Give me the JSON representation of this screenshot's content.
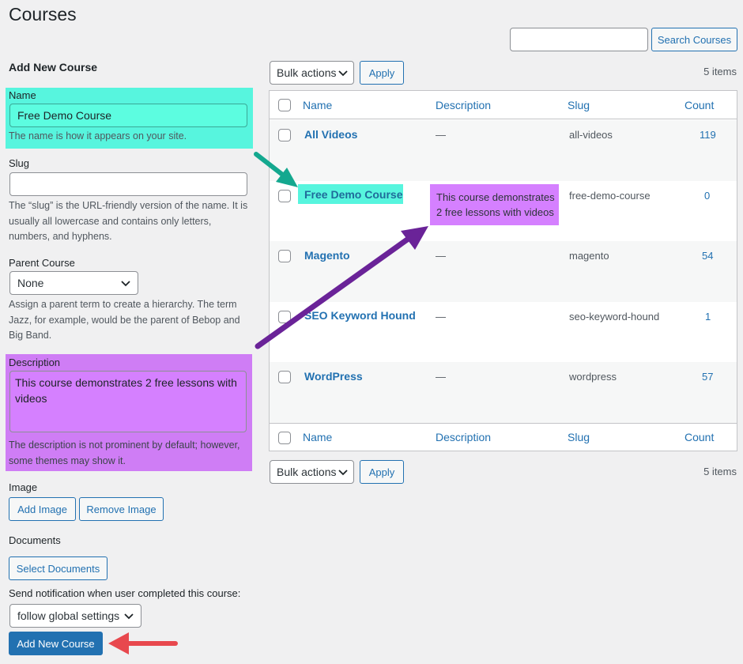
{
  "page": {
    "title": "Courses"
  },
  "search": {
    "input_value": "",
    "button_label": "Search Courses"
  },
  "form": {
    "heading": "Add New Course",
    "name": {
      "label": "Name",
      "value": "Free Demo Course",
      "help": "The name is how it appears on your site."
    },
    "slug": {
      "label": "Slug",
      "value": "",
      "help": "The “slug” is the URL-friendly version of the name. It is usually all lowercase and contains only letters, numbers, and hyphens."
    },
    "parent": {
      "label": "Parent Course",
      "selected": "None",
      "help": "Assign a parent term to create a hierarchy. The term Jazz, for example, would be the parent of Bebop and Big Band."
    },
    "description": {
      "label": "Description",
      "value": "This course demonstrates 2 free lessons with videos",
      "help": "The description is not prominent by default; however, some themes may show it."
    },
    "image": {
      "label": "Image",
      "add_label": "Add Image",
      "remove_label": "Remove Image"
    },
    "documents": {
      "label": "Documents",
      "select_label": "Select Documents"
    },
    "notification": {
      "label": "Send notification when user completed this course:",
      "selected": "follow global settings"
    },
    "submit_label": "Add New Course"
  },
  "toolbar": {
    "bulk_label": "Bulk actions",
    "apply_label": "Apply",
    "items_count": "5 items"
  },
  "table": {
    "columns": {
      "name": "Name",
      "description": "Description",
      "slug": "Slug",
      "count": "Count"
    },
    "rows": [
      {
        "name": "All Videos",
        "description": "—",
        "slug": "all-videos",
        "count": "119"
      },
      {
        "name": "Free Demo Course",
        "description": "This course demonstrates 2 free lessons with videos",
        "slug": "free-demo-course",
        "count": "0"
      },
      {
        "name": "Magento",
        "description": "—",
        "slug": "magento",
        "count": "54"
      },
      {
        "name": "SEO Keyword Hound",
        "description": "—",
        "slug": "seo-keyword-hound",
        "count": "1"
      },
      {
        "name": "WordPress",
        "description": "—",
        "slug": "wordpress",
        "count": "57"
      }
    ]
  },
  "colors": {
    "highlight_teal": "#57f5de",
    "highlight_purple": "#cf7df5",
    "arrow_teal": "#14a88f",
    "arrow_purple": "#6a2398",
    "arrow_red": "#e8484e",
    "primary_blue": "#2271b1"
  },
  "icons": {
    "dropdown": "chevron-down-icon",
    "annotation_arrows": [
      "teal-arrow-icon",
      "purple-arrow-icon",
      "red-arrow-icon"
    ]
  }
}
